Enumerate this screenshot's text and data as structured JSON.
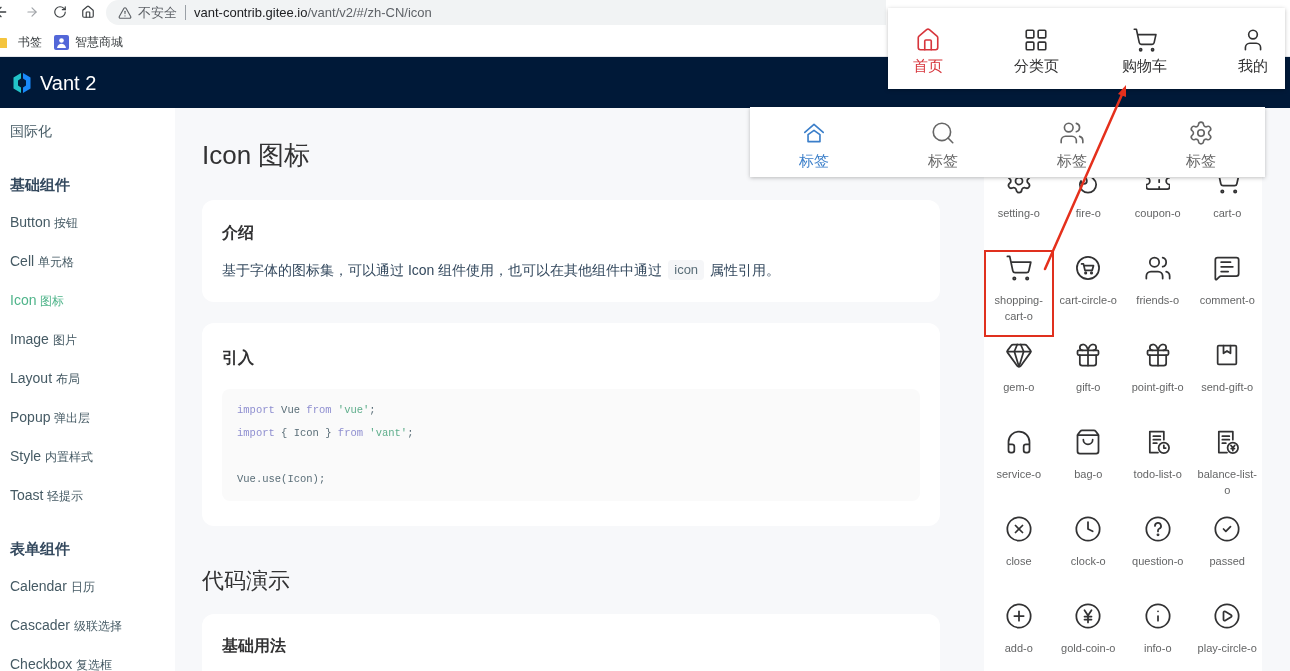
{
  "browser": {
    "security_label": "不安全",
    "url_host": "vant-contrib.gitee.io",
    "url_path": "/vant/v2/#/zh-CN/icon"
  },
  "bookmarks": [
    {
      "label": "书签"
    },
    {
      "label": "智慧商城"
    }
  ],
  "header": {
    "logo_text": "Vant 2"
  },
  "sidebar": {
    "items": [
      {
        "kind": "link",
        "title": "国际化",
        "selected": false
      },
      {
        "kind": "group",
        "title": "基础组件"
      },
      {
        "kind": "link",
        "title": "Button",
        "subtitle": "按钮",
        "selected": false
      },
      {
        "kind": "link",
        "title": "Cell",
        "subtitle": "单元格",
        "selected": false
      },
      {
        "kind": "link",
        "title": "Icon",
        "subtitle": "图标",
        "selected": true
      },
      {
        "kind": "link",
        "title": "Image",
        "subtitle": "图片",
        "selected": false
      },
      {
        "kind": "link",
        "title": "Layout",
        "subtitle": "布局",
        "selected": false
      },
      {
        "kind": "link",
        "title": "Popup",
        "subtitle": "弹出层",
        "selected": false
      },
      {
        "kind": "link",
        "title": "Style",
        "subtitle": "内置样式",
        "selected": false
      },
      {
        "kind": "link",
        "title": "Toast",
        "subtitle": "轻提示",
        "selected": false
      },
      {
        "kind": "group",
        "title": "表单组件"
      },
      {
        "kind": "link",
        "title": "Calendar",
        "subtitle": "日历",
        "selected": false
      },
      {
        "kind": "link",
        "title": "Cascader",
        "subtitle": "级联选择",
        "selected": false
      },
      {
        "kind": "link",
        "title": "Checkbox",
        "subtitle": "复选框",
        "selected": false
      }
    ]
  },
  "content": {
    "title": "Icon 图标",
    "intro": {
      "heading": "介绍",
      "text_before": "基于字体的图标集，可以通过 Icon 组件使用，也可以在其他组件中通过",
      "code": "icon",
      "text_after": "属性引用。"
    },
    "import": {
      "heading": "引入",
      "code_groups": [
        [
          [
            {
              "kind": "keyword",
              "text": "import"
            },
            {
              "kind": "plain",
              "text": " Vue "
            },
            {
              "kind": "keyword",
              "text": "from"
            },
            {
              "kind": "string",
              "text": " 'vue'"
            },
            {
              "kind": "plain",
              "text": ";"
            }
          ],
          [
            {
              "kind": "keyword",
              "text": "import"
            },
            {
              "kind": "plain",
              "text": " { Icon } "
            },
            {
              "kind": "keyword",
              "text": "from"
            },
            {
              "kind": "string",
              "text": " 'vant'"
            },
            {
              "kind": "plain",
              "text": ";"
            }
          ]
        ],
        [
          [
            {
              "kind": "plain",
              "text": "Vue.use(Icon);"
            }
          ]
        ]
      ]
    },
    "demo_heading": "代码演示",
    "demo": {
      "heading": "基础用法"
    }
  },
  "simulator": {
    "icons": [
      {
        "name": "setting-o",
        "highlighted": false
      },
      {
        "name": "fire-o",
        "highlighted": false
      },
      {
        "name": "coupon-o",
        "highlighted": false
      },
      {
        "name": "cart-o",
        "highlighted": false
      },
      {
        "name": "shopping-cart-o",
        "highlighted": true
      },
      {
        "name": "cart-circle-o",
        "highlighted": false
      },
      {
        "name": "friends-o",
        "highlighted": false
      },
      {
        "name": "comment-o",
        "highlighted": false
      },
      {
        "name": "gem-o",
        "highlighted": false
      },
      {
        "name": "gift-o",
        "highlighted": false
      },
      {
        "name": "point-gift-o",
        "highlighted": false
      },
      {
        "name": "send-gift-o",
        "highlighted": false
      },
      {
        "name": "service-o",
        "highlighted": false
      },
      {
        "name": "bag-o",
        "highlighted": false
      },
      {
        "name": "todo-list-o",
        "highlighted": false
      },
      {
        "name": "balance-list-o",
        "highlighted": false
      },
      {
        "name": "close",
        "highlighted": false
      },
      {
        "name": "clock-o",
        "highlighted": false
      },
      {
        "name": "question-o",
        "highlighted": false
      },
      {
        "name": "passed",
        "highlighted": false
      },
      {
        "name": "add-o",
        "highlighted": false
      },
      {
        "name": "gold-coin-o",
        "highlighted": false
      },
      {
        "name": "info-o",
        "highlighted": false
      },
      {
        "name": "play-circle-o",
        "highlighted": false
      }
    ]
  },
  "overlays": [
    {
      "items": [
        {
          "label": "首页",
          "selected": true
        },
        {
          "label": "分类页",
          "selected": false
        },
        {
          "label": "购物车",
          "selected": false
        },
        {
          "label": "我的",
          "selected": false
        }
      ]
    },
    {
      "items": [
        {
          "label": "标签",
          "selected": true
        },
        {
          "label": "标签",
          "selected": false
        },
        {
          "label": "标签",
          "selected": false
        },
        {
          "label": "标签",
          "selected": false
        }
      ]
    }
  ]
}
